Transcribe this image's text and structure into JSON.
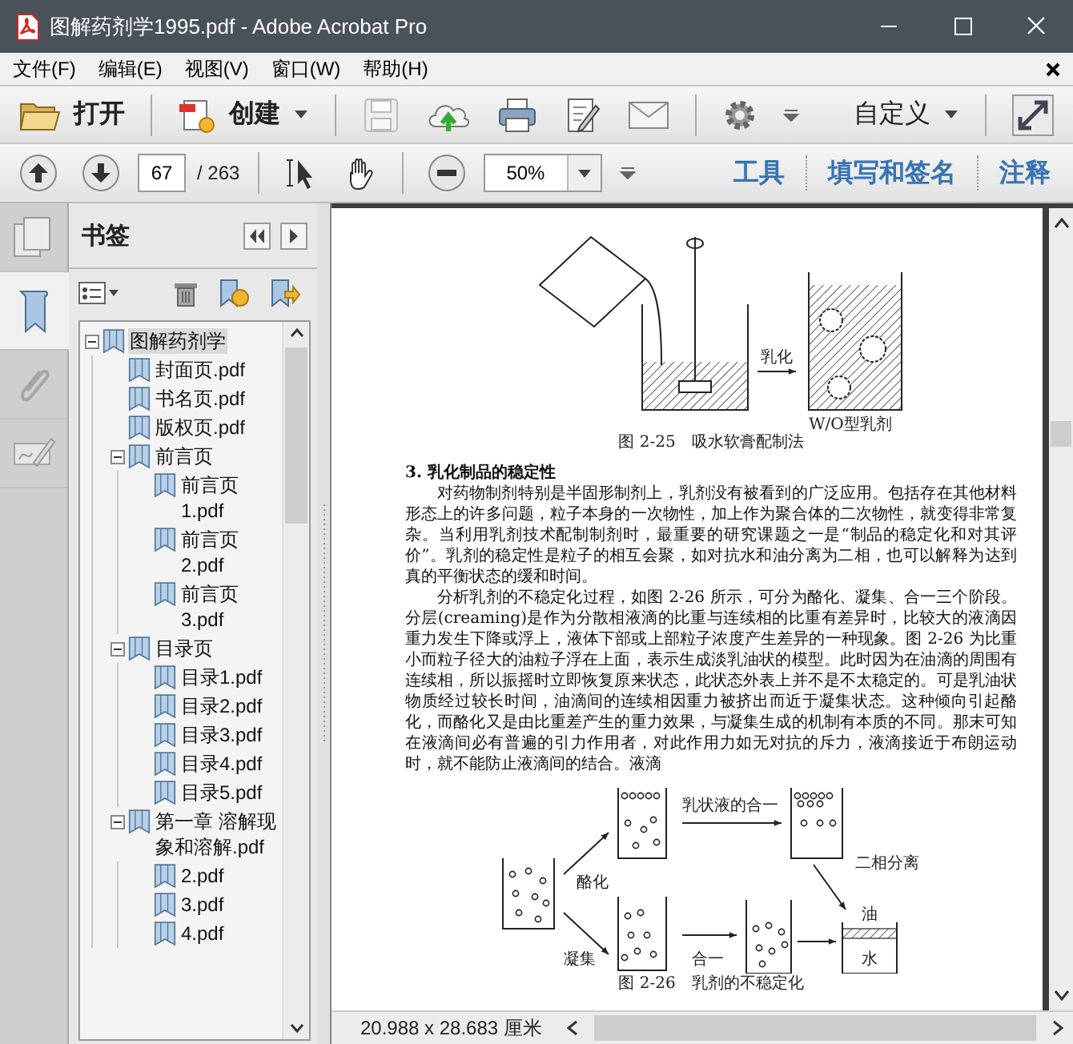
{
  "window": {
    "title": "图解药剂学1995.pdf - Adobe Acrobat Pro"
  },
  "menu": [
    "文件(F)",
    "编辑(E)",
    "视图(V)",
    "窗口(W)",
    "帮助(H)"
  ],
  "toolbar": {
    "open": "打开",
    "create": "创建",
    "customize": "自定义"
  },
  "nav": {
    "page": "67",
    "page_count": "/ 263",
    "zoom": "50%",
    "links": [
      "工具",
      "填写和签名",
      "注释"
    ]
  },
  "side_tabs": [
    {
      "kind": "pages",
      "selected": false
    },
    {
      "kind": "bookmarks",
      "selected": true
    },
    {
      "kind": "attachments",
      "selected": false
    },
    {
      "kind": "signatures",
      "selected": false
    }
  ],
  "bookmarks": {
    "title": "书签",
    "items": [
      {
        "label": "图解药剂学",
        "selected": true,
        "expanded": true,
        "children": [
          {
            "label": "封面页.pdf",
            "selected": false
          },
          {
            "label": "书名页.pdf",
            "selected": false
          },
          {
            "label": "版权页.pdf",
            "selected": false
          },
          {
            "label": "前言页",
            "selected": false,
            "expanded": true,
            "children": [
              {
                "label": "前言页1.pdf",
                "selected": false
              },
              {
                "label": "前言页2.pdf",
                "selected": false
              },
              {
                "label": "前言页3.pdf",
                "selected": false
              }
            ]
          },
          {
            "label": "目录页",
            "selected": false,
            "expanded": true,
            "children": [
              {
                "label": "目录1.pdf",
                "selected": false
              },
              {
                "label": "目录2.pdf",
                "selected": false
              },
              {
                "label": "目录3.pdf",
                "selected": false
              },
              {
                "label": "目录4.pdf",
                "selected": false
              },
              {
                "label": "目录5.pdf",
                "selected": false
              }
            ]
          },
          {
            "label": "第一章 溶解现象和溶解.pdf",
            "selected": false,
            "expanded": true,
            "children": [
              {
                "label": "2.pdf",
                "selected": false
              },
              {
                "label": "3.pdf",
                "selected": false
              },
              {
                "label": "4.pdf",
                "selected": false
              }
            ]
          }
        ]
      }
    ]
  },
  "document": {
    "figure_1": {
      "labels": [
        "乳化",
        "W/O型乳剂"
      ],
      "caption": "图 2-25　吸水软膏配制法"
    },
    "heading": "3. 乳化制品的稳定性",
    "paragraphs": [
      "对药物制剂特别是半固形制剂上，乳剂没有被看到的广泛应用。包括存在其他材料形态上的许多问题，粒子本身的一次物性，加上作为聚合体的二次物性，就变得非常复杂。当利用乳剂技术配制制剂时，最重要的研究课题之一是“制品的稳定化和对其评价”。乳剂的稳定性是粒子的相互会聚，如对抗水和油分离为二相，也可以解释为达到真的平衡状态的缓和时间。",
      "分析乳剂的不稳定化过程，如图 2-26 所示，可分为酪化、凝集、合一三个阶段。分层(creaming)是作为分散相液滴的比重与连续相的比重有差异时，比较大的液滴因重力发生下降或浮上，液体下部或上部粒子浓度产生差异的一种现象。图 2-26 为比重小而粒子径大的油粒子浮在上面，表示生成淡乳油状的模型。此时因为在油滴的周围有连续相，所以振摇时立即恢复原来状态，此状态外表上并不是不太稳定的。可是乳油状物质经过较长时间，油滴间的连续相因重力被挤出而近于凝集状态。这种倾向引起酪化，而酪化又是由比重差产生的重力效果，与凝集生成的机制有本质的不同。那末可知在液滴间必有普遍的引力作用者，对此作用力如无对抗的斥力，液滴接近于布朗运动时，就不能防止液滴间的结合。液滴"
    ],
    "figure_2": {
      "labels": [
        "酪化",
        "凝集",
        "乳状液的合一",
        "合一",
        "二相分离",
        "油",
        "水"
      ],
      "caption": "图 2-26　乳剂的不稳定化"
    }
  },
  "status_bar": {
    "size": "20.988 x 28.683 厘米"
  }
}
